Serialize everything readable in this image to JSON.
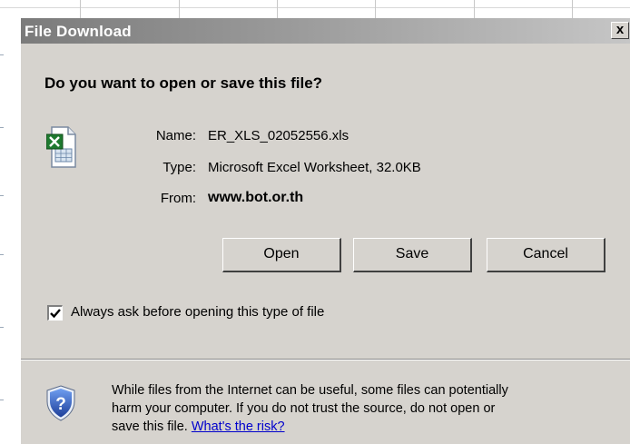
{
  "dialog": {
    "title": "File Download",
    "close_label": "x",
    "question": "Do you want to open or save this file?",
    "file": {
      "name_label": "Name:",
      "name_value": "ER_XLS_02052556.xls",
      "type_label": "Type:",
      "type_value": "Microsoft Excel Worksheet, 32.0KB",
      "from_label": "From:",
      "from_value": "www.bot.or.th",
      "icon": "excel-file-icon"
    },
    "buttons": {
      "open": "Open",
      "save": "Save",
      "cancel": "Cancel"
    },
    "always_ask": {
      "label": "Always ask before opening this type of file",
      "checked": true
    },
    "warning": {
      "icon": "shield-question-icon",
      "line1": "While files from the Internet can be useful, some files can potentially",
      "line2": "harm your computer. If you do not trust the source, do not open or",
      "line3": "save this file.",
      "link": "What's the risk?"
    }
  },
  "colors": {
    "dialog_bg": "#d6d3ce",
    "titlebar_start": "#7b7b7b",
    "titlebar_end": "#c6c6c6",
    "link": "#0000cc"
  }
}
